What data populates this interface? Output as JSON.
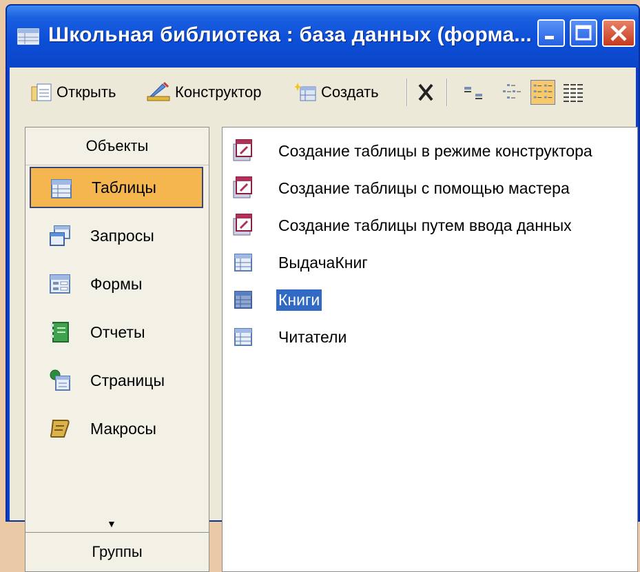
{
  "window": {
    "title": "Школьная библиотека : база данных (форма...",
    "buttons": {
      "minimize": "_",
      "maximize": "□",
      "close": "X"
    }
  },
  "toolbar": {
    "open_label": "Открыть",
    "design_label": "Конструктор",
    "new_label": "Создать",
    "view_icons": [
      "large-icons-icon",
      "small-icons-icon",
      "list-icon",
      "details-icon"
    ],
    "active_view": "list-icon"
  },
  "objects_bar": {
    "header": "Объекты",
    "items": [
      {
        "label": "Таблицы",
        "icon": "table-icon",
        "selected": true
      },
      {
        "label": "Запросы",
        "icon": "query-icon"
      },
      {
        "label": "Формы",
        "icon": "form-icon"
      },
      {
        "label": "Отчеты",
        "icon": "report-icon"
      },
      {
        "label": "Страницы",
        "icon": "page-icon"
      },
      {
        "label": "Макросы",
        "icon": "macro-icon"
      }
    ],
    "more": "▼",
    "groups_label": "Группы"
  },
  "object_list": {
    "items": [
      {
        "label": "Создание таблицы в режиме конструктора",
        "icon": "wizard-icon"
      },
      {
        "label": "Создание таблицы с помощью мастера",
        "icon": "wizard-icon"
      },
      {
        "label": "Создание таблицы путем ввода данных",
        "icon": "wizard-icon"
      },
      {
        "label": "ВыдачаКниг",
        "icon": "table-icon"
      },
      {
        "label": "Книги",
        "icon": "table-icon",
        "selected": true
      },
      {
        "label": "Читатели",
        "icon": "table-icon"
      }
    ]
  },
  "colors": {
    "titlebar": "#0d4fd8",
    "selection": "#316ac5",
    "nav_selected": "#f5b64f",
    "background": "#ece9d8"
  }
}
